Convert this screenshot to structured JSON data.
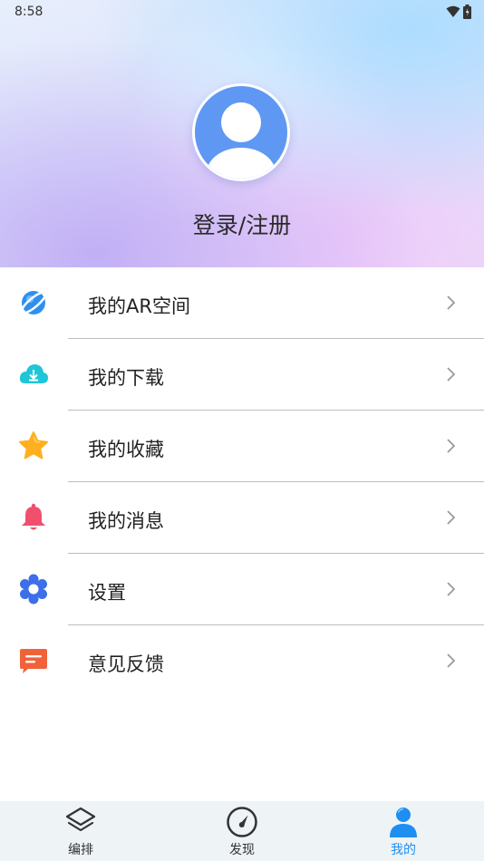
{
  "status_bar": {
    "time": "8:58",
    "icons": [
      "wifi-icon",
      "battery-icon"
    ]
  },
  "profile": {
    "avatar_icon": "user-avatar-icon",
    "login_label": "登录/注册"
  },
  "menu": {
    "items": [
      {
        "label": "我的AR空间",
        "icon": "planet-icon",
        "color": "#2f8ff0"
      },
      {
        "label": "我的下载",
        "icon": "cloud-download-icon",
        "color": "#1fc6d8"
      },
      {
        "label": "我的收藏",
        "icon": "star-icon",
        "color": "#ffb020"
      },
      {
        "label": "我的消息",
        "icon": "bell-icon",
        "color": "#f0506e"
      },
      {
        "label": "设置",
        "icon": "gear-icon",
        "color": "#3d6fe8"
      },
      {
        "label": "意见反馈",
        "icon": "feedback-icon",
        "color": "#f2623a"
      }
    ]
  },
  "tabbar": {
    "tabs": [
      {
        "label": "编排",
        "icon": "layers-icon",
        "active": false
      },
      {
        "label": "发现",
        "icon": "compass-icon",
        "active": false
      },
      {
        "label": "我的",
        "icon": "person-icon",
        "active": true
      }
    ],
    "active_color": "#1e8ff0"
  }
}
